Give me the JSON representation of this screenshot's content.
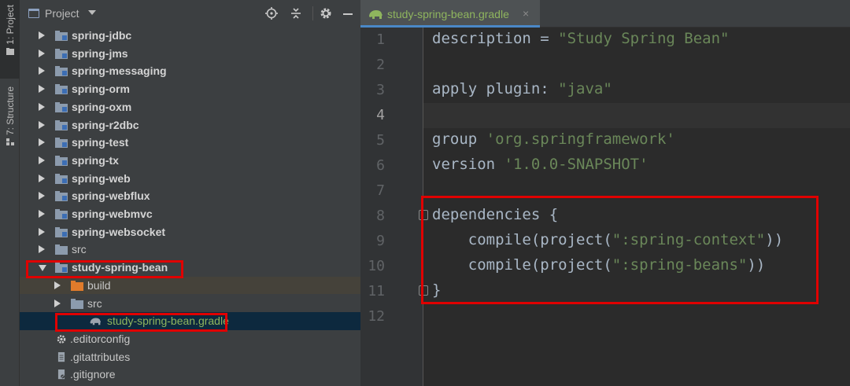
{
  "tool_window_bar": {
    "project_tab": "1: Project",
    "structure_tab": "7: Structure"
  },
  "project_panel": {
    "title": "Project",
    "tree": [
      {
        "label": "spring-jdbc",
        "type": "module",
        "expanded": false
      },
      {
        "label": "spring-jms",
        "type": "module",
        "expanded": false
      },
      {
        "label": "spring-messaging",
        "type": "module",
        "expanded": false
      },
      {
        "label": "spring-orm",
        "type": "module",
        "expanded": false
      },
      {
        "label": "spring-oxm",
        "type": "module",
        "expanded": false
      },
      {
        "label": "spring-r2dbc",
        "type": "module",
        "expanded": false
      },
      {
        "label": "spring-test",
        "type": "module",
        "expanded": false
      },
      {
        "label": "spring-tx",
        "type": "module",
        "expanded": false
      },
      {
        "label": "spring-web",
        "type": "module",
        "expanded": false
      },
      {
        "label": "spring-webflux",
        "type": "module",
        "expanded": false
      },
      {
        "label": "spring-webmvc",
        "type": "module",
        "expanded": false
      },
      {
        "label": "spring-websocket",
        "type": "module",
        "expanded": false
      },
      {
        "label": "src",
        "type": "folder",
        "expanded": false
      },
      {
        "label": "study-spring-bean",
        "type": "module",
        "expanded": true
      },
      {
        "label": "build",
        "type": "build-folder",
        "expanded": false
      },
      {
        "label": "src",
        "type": "folder",
        "expanded": false
      },
      {
        "label": "study-spring-bean.gradle",
        "type": "gradle-file",
        "selected": true
      },
      {
        "label": ".editorconfig",
        "type": "config-file"
      },
      {
        "label": ".gitattributes",
        "type": "text-file"
      },
      {
        "label": ".gitignore",
        "type": "ignore-file"
      }
    ]
  },
  "editor": {
    "tab": {
      "label": "study-spring-bean.gradle",
      "close": "×"
    },
    "current_line": 4,
    "lines": [
      {
        "num": "1"
      },
      {
        "num": "2"
      },
      {
        "num": "3"
      },
      {
        "num": "4"
      },
      {
        "num": "5"
      },
      {
        "num": "6"
      },
      {
        "num": "7"
      },
      {
        "num": "8"
      },
      {
        "num": "9"
      },
      {
        "num": "10"
      },
      {
        "num": "11"
      },
      {
        "num": "12"
      }
    ],
    "code": {
      "l1_a": "description = ",
      "l1_s": "\"Study Spring Bean\"",
      "l3_a": "apply plugin: ",
      "l3_s": "\"java\"",
      "l5_a": "group ",
      "l5_s": "'org.springframework'",
      "l6_a": "version ",
      "l6_s": "'1.0.0-SNAPSHOT'",
      "l8": "dependencies {",
      "l9_a": "    compile(project(",
      "l9_s": "\":spring-context\"",
      "l9_b": "))",
      "l10_a": "    compile(project(",
      "l10_s": "\":spring-beans\"",
      "l10_b": "))",
      "l11": "}"
    }
  },
  "colors": {
    "background": "#2b2b2b",
    "panel": "#3c3f41",
    "string": "#6a8759",
    "selection": "#0d293e",
    "annotation_box": "#e00000"
  }
}
